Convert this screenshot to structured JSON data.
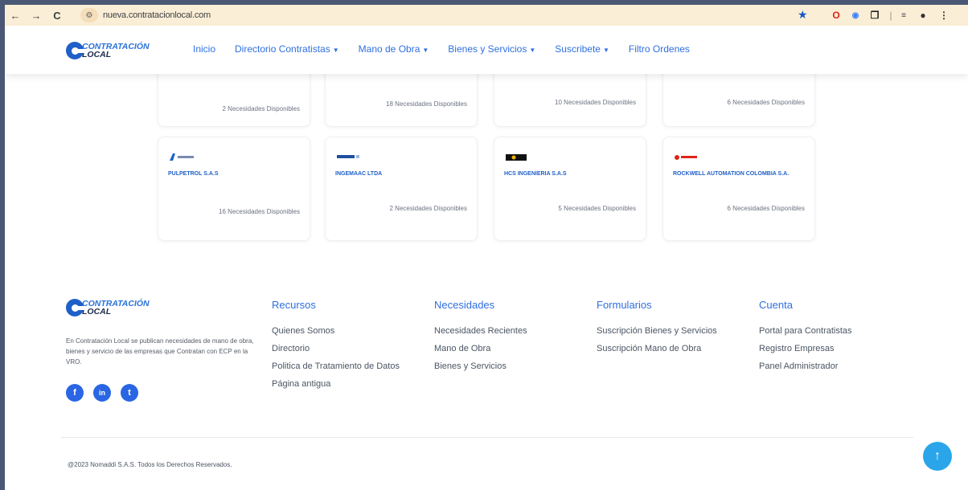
{
  "browser": {
    "url": "nueva.contratacionlocal.com",
    "back_icon": "←",
    "forward_icon": "→",
    "reload_icon": "C",
    "site_info_icon": "⚙",
    "star_icon": "★"
  },
  "header": {
    "logo_line1": "CONTRATACIÓN",
    "logo_line2": "LOCAL",
    "menu": [
      {
        "label": "Inicio",
        "dropdown": false
      },
      {
        "label": "Directorio Contratistas",
        "dropdown": true
      },
      {
        "label": "Mano de Obra",
        "dropdown": true
      },
      {
        "label": "Bienes y Servicios",
        "dropdown": true
      },
      {
        "label": "Suscribete",
        "dropdown": true
      },
      {
        "label": "Filtro Ordenes",
        "dropdown": false
      }
    ]
  },
  "cards_top": [
    {
      "needs": "2 Necesidades Disponibles"
    },
    {
      "needs": "18 Necesidades Disponibles"
    },
    {
      "needs": "10 Necesidades Disponibles"
    },
    {
      "needs": "6 Necesidades Disponibles"
    }
  ],
  "cards_bottom": [
    {
      "name": "PULPETROL S.A.S",
      "needs": "16 Necesidades Disponibles"
    },
    {
      "name": "INGEMAAC LTDA",
      "needs": "2 Necesidades Disponibles"
    },
    {
      "name": "HCS INGENIERIA S.A.S",
      "needs": "5 Necesidades Disponibles"
    },
    {
      "name": "ROCKWELL AUTOMATION COLOMBIA S.A.",
      "needs": "6 Necesidades Disponibles"
    }
  ],
  "footer": {
    "logo_line1": "CONTRATACIÓN",
    "logo_line2": "LOCAL",
    "description": "En Contratación Local se publican necesidades de mano de obra, bienes y servicio de las empresas que Contratan con ECP en la VRO.",
    "social": [
      {
        "icon": "f",
        "name": "facebook"
      },
      {
        "icon": "in",
        "name": "linkedin"
      },
      {
        "icon": "t",
        "name": "twitter"
      }
    ],
    "columns": [
      {
        "title": "Recursos",
        "links": [
          "Quienes Somos",
          "Directorio",
          "Politica de Tratamiento de Datos",
          "Página antigua"
        ]
      },
      {
        "title": "Necesidades",
        "links": [
          "Necesidades Recientes",
          "Mano de Obra",
          "Bienes y Servicios"
        ]
      },
      {
        "title": "Formularios",
        "links": [
          "Suscripción Bienes y Servicios",
          "Suscripción Mano de Obra"
        ]
      },
      {
        "title": "Cuenta",
        "links": [
          "Portal para Contratistas",
          "Registro Empresas",
          "Panel Administrador"
        ]
      }
    ],
    "copyright": "@2023 Nomaddi S.A.S. Todos los Derechos Reservados.",
    "to_top_icon": "↑"
  }
}
